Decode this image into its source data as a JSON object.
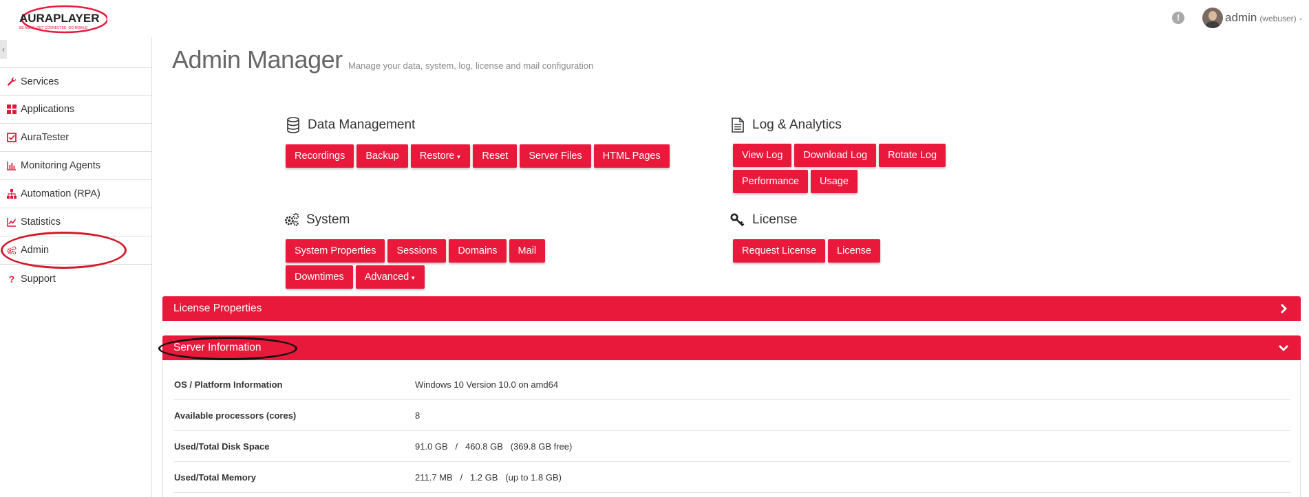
{
  "brand": {
    "name": "AURAPLAYER",
    "tagline": "BE AGILE, GET CONNECTED, GO MOBILE",
    "accent_color": "#e8193b"
  },
  "header": {
    "info_icon": "exclamation-circle-icon",
    "user": {
      "name": "admin",
      "role": "(webuser)",
      "caret": "chevron-down-icon"
    }
  },
  "sidebar": {
    "collapse_glyph": "‹",
    "items": [
      {
        "label": "Services",
        "icon": "wrench-icon"
      },
      {
        "label": "Applications",
        "icon": "grid-icon"
      },
      {
        "label": "AuraTester",
        "icon": "checkbox-icon"
      },
      {
        "label": "Monitoring Agents",
        "icon": "bar-chart-icon"
      },
      {
        "label": "Automation (RPA)",
        "icon": "sitemap-icon"
      },
      {
        "label": "Statistics",
        "icon": "line-chart-icon"
      },
      {
        "label": "Admin",
        "icon": "cogs-icon"
      },
      {
        "label": "Support",
        "icon": "question-icon"
      }
    ]
  },
  "page": {
    "title": "Admin Manager",
    "subtitle": "Manage your data, system, log, license and mail configuration"
  },
  "sections": {
    "data_management": {
      "title": "Data Management",
      "icon": "database-icon",
      "buttons": [
        "Recordings",
        "Backup",
        "Restore",
        "Reset",
        "Server Files",
        "HTML Pages"
      ]
    },
    "log_analytics": {
      "title": "Log & Analytics",
      "icon": "file-text-icon",
      "buttons": [
        "View Log",
        "Download Log",
        "Rotate Log",
        "Performance",
        "Usage"
      ]
    },
    "system": {
      "title": "System",
      "icon": "cogs-icon",
      "buttons": [
        "System Properties",
        "Sessions",
        "Domains",
        "Mail",
        "Downtimes",
        "Advanced"
      ]
    },
    "license": {
      "title": "License",
      "icon": "key-icon",
      "buttons": [
        "Request License",
        "License"
      ]
    }
  },
  "panels": {
    "license_properties": {
      "title": "License Properties",
      "icon": "chevron-right-icon",
      "expanded": false
    },
    "server_information": {
      "title": "Server Information",
      "icon": "chevron-down-icon",
      "expanded": true,
      "rows": [
        {
          "label": "OS / Platform Information",
          "value": "Windows 10 Version 10.0 on amd64"
        },
        {
          "label": "Available processors (cores)",
          "value": "8"
        },
        {
          "label": "Used/Total Disk Space",
          "value": "91.0 GB   /   460.8 GB   (369.8 GB free)"
        },
        {
          "label": "Used/Total Memory",
          "value": "211.7 MB   /   1.2 GB   (up to 1.8 GB)"
        }
      ]
    }
  },
  "annotations": {
    "red_oval_color": "#d21b2a",
    "black_oval_color": "#111111"
  }
}
